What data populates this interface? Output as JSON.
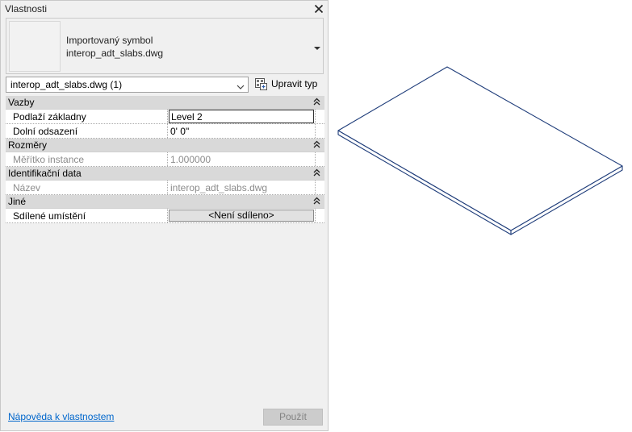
{
  "palette": {
    "title": "Vlastnosti",
    "type_selector": {
      "line1": "Importovaný symbol",
      "line2": "interop_adt_slabs.dwg"
    },
    "instance_filter": "interop_adt_slabs.dwg (1)",
    "edit_type_label": "Upravit typ",
    "groups": [
      {
        "label": "Vazby",
        "rows": [
          {
            "name": "Podlaží základny",
            "value": "Level 2"
          },
          {
            "name": "Dolní odsazení",
            "value": "0'  0\""
          }
        ]
      },
      {
        "label": "Rozměry",
        "rows": [
          {
            "name": "Měřítko instance",
            "value": "1.000000"
          }
        ]
      },
      {
        "label": "Identifikační data",
        "rows": [
          {
            "name": "Název",
            "value": "interop_adt_slabs.dwg"
          }
        ]
      },
      {
        "label": "Jiné",
        "rows": [
          {
            "name": "Sdílené umístění",
            "value": "<Není sdíleno>"
          }
        ]
      }
    ],
    "help_link": "Nápověda k vlastnostem",
    "apply_label": "Použít"
  },
  "colors": {
    "slab_edge": "#1f3d7a",
    "group_header_bg": "#d9d9d9",
    "link": "#0066cc"
  },
  "icons": {
    "close": "close-icon",
    "dropdown": "chevron-down-icon",
    "edit_type": "edit-type-icon",
    "collapse": "collapse-up-icon"
  }
}
